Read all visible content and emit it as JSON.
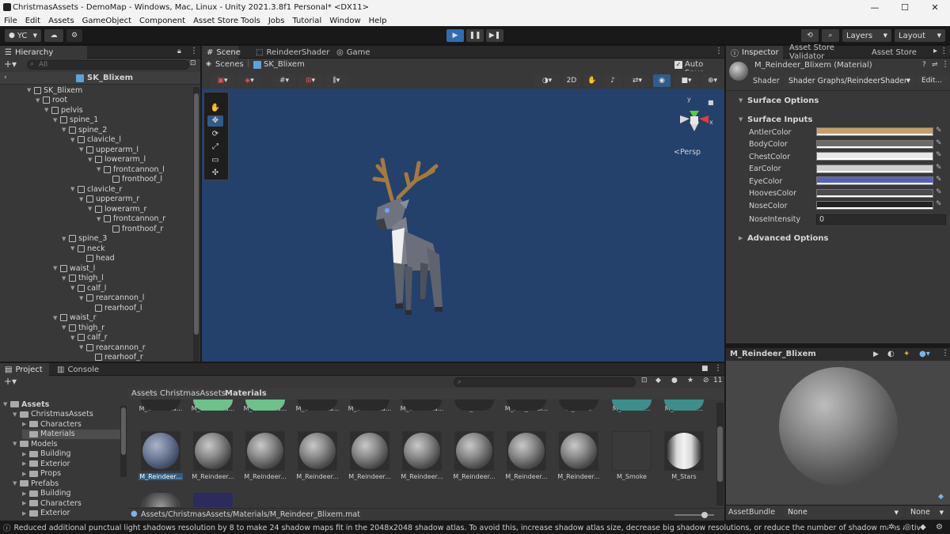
{
  "window": {
    "title": "ChristmasAssets - DemoMap - Windows, Mac, Linux - Unity 2021.3.8f1 Personal* <DX11>",
    "minimize": "—",
    "maximize": "☐",
    "close": "✕"
  },
  "menu": [
    "File",
    "Edit",
    "Assets",
    "GameObject",
    "Component",
    "Asset Store Tools",
    "Jobs",
    "Tutorial",
    "Window",
    "Help"
  ],
  "toolbar": {
    "account": "YC",
    "layers": "Layers",
    "layout": "Layout"
  },
  "hierarchy": {
    "tab": "Hierarchy",
    "search_placeholder": "All",
    "scene": "SK_Blixem",
    "items": [
      {
        "label": "SK_Blixem",
        "depth": 0,
        "arrow": true
      },
      {
        "label": "root",
        "depth": 1,
        "arrow": true
      },
      {
        "label": "pelvis",
        "depth": 2,
        "arrow": true
      },
      {
        "label": "spine_1",
        "depth": 3,
        "arrow": true
      },
      {
        "label": "spine_2",
        "depth": 4,
        "arrow": true
      },
      {
        "label": "clavicle_l",
        "depth": 5,
        "arrow": true
      },
      {
        "label": "upperarm_l",
        "depth": 6,
        "arrow": true
      },
      {
        "label": "lowerarm_l",
        "depth": 7,
        "arrow": true
      },
      {
        "label": "frontcannon_l",
        "depth": 8,
        "arrow": true
      },
      {
        "label": "fronthoof_l",
        "depth": 9,
        "arrow": false
      },
      {
        "label": "clavicle_r",
        "depth": 5,
        "arrow": true
      },
      {
        "label": "upperarm_r",
        "depth": 6,
        "arrow": true
      },
      {
        "label": "lowerarm_r",
        "depth": 7,
        "arrow": true
      },
      {
        "label": "frontcannon_r",
        "depth": 8,
        "arrow": true
      },
      {
        "label": "fronthoof_r",
        "depth": 9,
        "arrow": false
      },
      {
        "label": "spine_3",
        "depth": 4,
        "arrow": true
      },
      {
        "label": "neck",
        "depth": 5,
        "arrow": true
      },
      {
        "label": "head",
        "depth": 6,
        "arrow": false
      },
      {
        "label": "waist_l",
        "depth": 3,
        "arrow": true
      },
      {
        "label": "thigh_l",
        "depth": 4,
        "arrow": true
      },
      {
        "label": "calf_l",
        "depth": 5,
        "arrow": true
      },
      {
        "label": "rearcannon_l",
        "depth": 6,
        "arrow": true
      },
      {
        "label": "rearhoof_l",
        "depth": 7,
        "arrow": false
      },
      {
        "label": "waist_r",
        "depth": 3,
        "arrow": true
      },
      {
        "label": "thigh_r",
        "depth": 4,
        "arrow": true
      },
      {
        "label": "calf_r",
        "depth": 5,
        "arrow": true
      },
      {
        "label": "rearcannon_r",
        "depth": 6,
        "arrow": true
      },
      {
        "label": "rearhoof_r",
        "depth": 7,
        "arrow": false
      }
    ]
  },
  "scene_view": {
    "tabs": [
      "Scene",
      "ReindeerShader",
      "Game"
    ],
    "scenes_label": "Scenes",
    "breadcrumb": "SK_Blixem",
    "auto_save": "Auto Save",
    "mode_2d": "2D",
    "persp": "<Persp",
    "gizmo_y": "y",
    "gizmo_x": "x"
  },
  "inspector": {
    "tabs": [
      "Inspector",
      "Asset Store Validator",
      "Asset Store"
    ],
    "material": "M_Reindeer_Blixem (Material)",
    "shader_label": "Shader",
    "shader_value": "Shader Graphs/ReindeerShader",
    "edit": "Edit...",
    "surface_options": "Surface Options",
    "surface_inputs": "Surface Inputs",
    "props": [
      {
        "name": "AntlerColor",
        "color": "#c79d66"
      },
      {
        "name": "BodyColor",
        "color": "#6b6b6b"
      },
      {
        "name": "ChestColor",
        "color": "#e8e8e8"
      },
      {
        "name": "EarColor",
        "color": "#cfcfcf"
      },
      {
        "name": "EyeColor",
        "color": "#5561c2"
      },
      {
        "name": "HoovesColor",
        "color": "#4b4b4b"
      },
      {
        "name": "NoseColor",
        "color": "#232323"
      }
    ],
    "nose_intensity_label": "NoseIntensity",
    "nose_intensity_value": "0",
    "advanced_options": "Advanced Options"
  },
  "preview": {
    "title": "M_Reindeer_Blixem",
    "asset_bundle_label": "AssetBundle",
    "bundle_value": "None",
    "variant_value": "None"
  },
  "project": {
    "tabs": [
      "Project",
      "Console"
    ],
    "badge": "11",
    "breadcrumb": [
      "Assets",
      "ChristmasAssets",
      "Materials"
    ],
    "tree": [
      {
        "label": "Assets",
        "depth": 0,
        "arrow": true,
        "bold": true
      },
      {
        "label": "ChristmasAssets",
        "depth": 1,
        "arrow": true
      },
      {
        "label": "Characters",
        "depth": 2,
        "arrow": true
      },
      {
        "label": "Materials",
        "depth": 2,
        "arrow": false,
        "selected": true
      },
      {
        "label": "Models",
        "depth": 1,
        "arrow": true
      },
      {
        "label": "Building",
        "depth": 2,
        "arrow": true
      },
      {
        "label": "Exterior",
        "depth": 2,
        "arrow": true
      },
      {
        "label": "Props",
        "depth": 2,
        "arrow": true
      },
      {
        "label": "Prefabs",
        "depth": 1,
        "arrow": true
      },
      {
        "label": "Building",
        "depth": 2,
        "arrow": true
      },
      {
        "label": "Characters",
        "depth": 2,
        "arrow": true
      },
      {
        "label": "Exterior",
        "depth": 2,
        "arrow": true
      }
    ],
    "row1": [
      "M_Christma...",
      "M_Christma...",
      "M_Christma...",
      "M_Christma...",
      "M_Christma...",
      "M_Christma...",
      "M_Fire",
      "M_Fire_Addi...",
      "M_Glass",
      "M_Norther...",
      "M_Norther..."
    ],
    "row2": [
      "M_Reindeer...",
      "M_Reindeer...",
      "M_Reindeer...",
      "M_Reindeer...",
      "M_Reindeer...",
      "M_Reindeer...",
      "M_Reindeer...",
      "M_Reindeer...",
      "M_Reindeer...",
      "M_Smoke",
      "M_Stars"
    ],
    "path": "Assets/ChristmasAssets/Materials/M_Reindeer_Blixem.mat"
  },
  "status": "Reduced additional punctual light shadows resolution by 8 to make 24 shadow maps fit in the 2048x2048 shadow atlas. To avoid this, increase shadow atlas size, decrease big shadow resolutions, or reduce the number of shadow maps active"
}
